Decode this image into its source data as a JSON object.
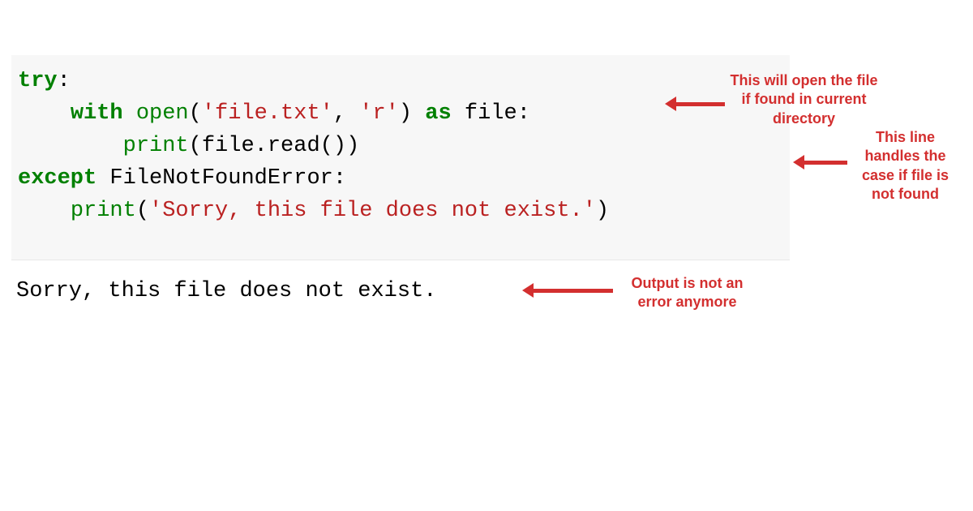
{
  "code": {
    "line1_kw": "try",
    "line1_colon": ":",
    "line2_indent": "    ",
    "line2_kw": "with",
    "line2_sp": " ",
    "line2_fn": "open",
    "line2_open": "(",
    "line2_str1": "'file.txt'",
    "line2_comma": ", ",
    "line2_str2": "'r'",
    "line2_close": ") ",
    "line2_kw2": "as",
    "line2_rest": " file:",
    "line3_indent": "        ",
    "line3_fn": "print",
    "line3_rest": "(file.read())",
    "line4_kw": "except",
    "line4_rest": " FileNotFoundError:",
    "line5_indent": "    ",
    "line5_fn": "print",
    "line5_open": "(",
    "line5_str": "'Sorry, this file does not exist.'",
    "line5_close": ")"
  },
  "output": "Sorry, this file does not exist.",
  "annotations": {
    "ann1": "This will open the file if found in current directory",
    "ann2": "This line handles the case if file is not found",
    "ann3": "Output is not an error anymore"
  },
  "colors": {
    "keyword": "#008000",
    "string": "#ba2121",
    "annotation": "#d32f2f",
    "codebg": "#f7f7f7"
  }
}
